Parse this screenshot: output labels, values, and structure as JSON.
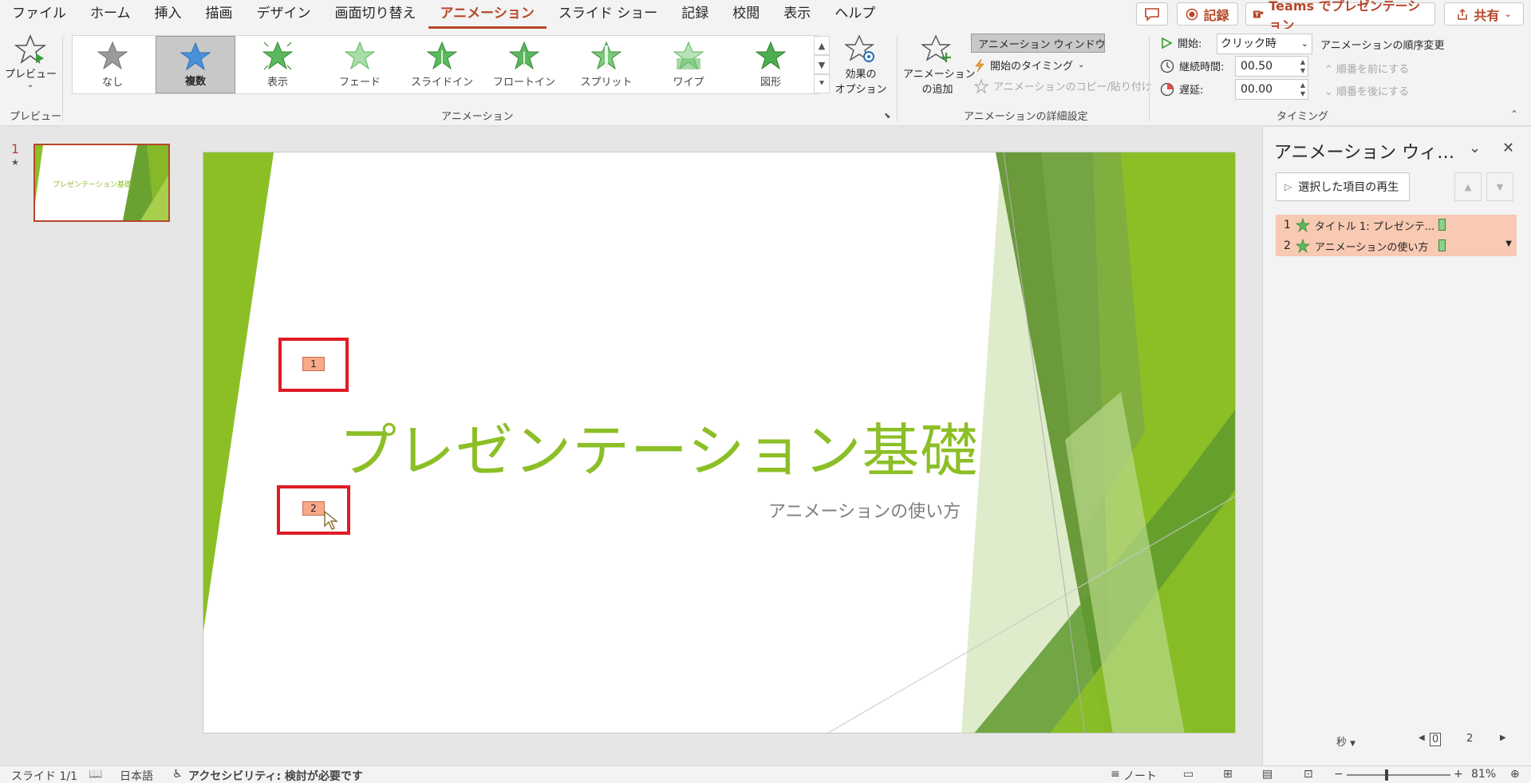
{
  "menu": {
    "tabs": [
      "ファイル",
      "ホーム",
      "挿入",
      "描画",
      "デザイン",
      "画面切り替え",
      "アニメーション",
      "スライド ショー",
      "記録",
      "校閲",
      "表示",
      "ヘルプ"
    ],
    "active_tab": "アニメーション",
    "record_label": "記録",
    "teams_label": "Teams でプレゼンテーション",
    "share_label": "共有"
  },
  "ribbon": {
    "preview_label": "プレビュー",
    "preview_group": "プレビュー",
    "animation_group": "アニメーション",
    "gallery": [
      "なし",
      "複数",
      "表示",
      "フェード",
      "スライドイン",
      "フロートイン",
      "スプリット",
      "ワイプ",
      "図形"
    ],
    "gallery_selected": "複数",
    "effect_options_line1": "効果の",
    "effect_options_line2": "オプション",
    "add_animation_line1": "アニメーション",
    "add_animation_line2": "の追加",
    "animation_window": "アニメーション ウィンドウ",
    "start_timing": "開始のタイミング",
    "copy_animation": "アニメーションのコピー/貼り付け",
    "advanced_group": "アニメーションの詳細設定",
    "start_label": "開始:",
    "start_value": "クリック時",
    "duration_label": "継続時間:",
    "duration_value": "00.50",
    "delay_label": "遅延:",
    "delay_value": "00.00",
    "reorder_label": "アニメーションの順序変更",
    "move_earlier": "順番を前にする",
    "move_later": "順番を後にする",
    "timing_group": "タイミング"
  },
  "thumbnails": {
    "slide_number": "1",
    "thumb_title": "プレゼンテーション基礎"
  },
  "slide": {
    "title": "プレゼンテーション基礎",
    "subtitle": "アニメーションの使い方",
    "tag1": "1",
    "tag2": "2"
  },
  "pane": {
    "title": "アニメーション ウィ…",
    "play_selected": "選択した項目の再生",
    "items": [
      {
        "num": "1",
        "label": "タイトル 1: プレゼンテ..."
      },
      {
        "num": "2",
        "label": "アニメーションの使い方"
      }
    ],
    "seconds": "秒",
    "timeline_start": "0",
    "timeline_mark": "2"
  },
  "status": {
    "slide": "スライド 1/1",
    "language": "日本語",
    "accessibility": "アクセシビリティ: 検討が必要です",
    "notes": "ノート",
    "zoom": "81%"
  },
  "colors": {
    "accent": "#b7472a",
    "slide_green": "#8cbf26",
    "anim_highlight": "#f8c9b3",
    "marker_red": "#e01b24"
  }
}
